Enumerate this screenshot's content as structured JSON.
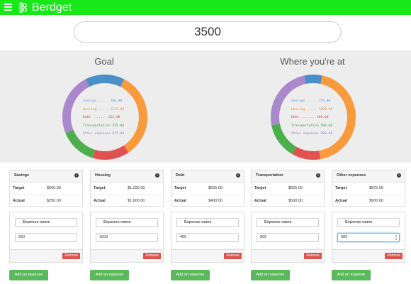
{
  "header": {
    "brand": "Berdget",
    "bar_color": "#18e818"
  },
  "income": {
    "value": "3500"
  },
  "charts": {
    "goal": {
      "title": "Goal",
      "legend": [
        {
          "text": "Savings ..... 560.00",
          "color": "#5b9bd5"
        },
        {
          "text": "Housing ..... 1225.00",
          "color": "#f0903a"
        },
        {
          "text": "Debt ....... 525.00",
          "color": "#d94e4e"
        },
        {
          "text": "Transportation 525.00",
          "color": "#3fa34d"
        },
        {
          "text": "Other expenses 875.00",
          "color": "#9b7fd0"
        }
      ]
    },
    "actual": {
      "title": "Where you're at",
      "legend": [
        {
          "text": "Savings ..... 250.00",
          "color": "#5b9bd5"
        },
        {
          "text": "Housing ..... 1600.00",
          "color": "#f0903a"
        },
        {
          "text": "Debt ....... 400.00",
          "color": "#d94e4e"
        },
        {
          "text": "Transportation 500.00",
          "color": "#3fa34d"
        },
        {
          "text": "Other expenses 900.00",
          "color": "#9b7fd0"
        }
      ]
    }
  },
  "chart_data": [
    {
      "type": "pie",
      "title": "Goal",
      "categories": [
        "Savings",
        "Housing",
        "Debt",
        "Transportation",
        "Other expenses"
      ],
      "values": [
        560,
        1225,
        525,
        525,
        875
      ],
      "colors": [
        "#4a8fc7",
        "#f99a3d",
        "#e05252",
        "#4cae4c",
        "#a988cc"
      ]
    },
    {
      "type": "pie",
      "title": "Where you're at",
      "categories": [
        "Savings",
        "Housing",
        "Debt",
        "Transportation",
        "Other expenses"
      ],
      "values": [
        250,
        1600,
        400,
        500,
        900
      ],
      "colors": [
        "#4a8fc7",
        "#f99a3d",
        "#e05252",
        "#4cae4c",
        "#a988cc"
      ]
    }
  ],
  "categories": [
    {
      "name": "Savings",
      "target_label": "Target",
      "target": "$560.00",
      "actual_label": "Actual",
      "actual": "$250.00",
      "info": "i",
      "expense_placeholder": "Expense name",
      "expense_amount": "250",
      "remove": "Remove",
      "add": "Add an expense"
    },
    {
      "name": "Housing",
      "target_label": "Target",
      "target": "$1,225.00",
      "actual_label": "Actual",
      "actual": "$1,600.00",
      "info": "i",
      "expense_placeholder": "Expense name",
      "expense_amount": "1600",
      "remove": "Remove",
      "add": "Add an expense"
    },
    {
      "name": "Debt",
      "target_label": "Target",
      "target": "$525.00",
      "actual_label": "Actual",
      "actual": "$400.00",
      "info": "i",
      "expense_placeholder": "Expense name",
      "expense_amount": "400",
      "remove": "Remove",
      "add": "Add an expense"
    },
    {
      "name": "Transportation",
      "target_label": "Target",
      "target": "$525.00",
      "actual_label": "Actual",
      "actual": "$500.00",
      "info": "i",
      "expense_placeholder": "Expense name",
      "expense_amount": "500",
      "remove": "Remove",
      "add": "Add an expense"
    },
    {
      "name": "Other expenses",
      "target_label": "Target",
      "target": "$875.00",
      "actual_label": "Actual",
      "actual": "$900.00",
      "info": "i",
      "expense_placeholder": "Expense name",
      "expense_amount": "900",
      "remove": "Remove",
      "add": "Add an expense"
    }
  ],
  "colors": {
    "remove": "#d9534f",
    "add": "#5cb85c"
  }
}
